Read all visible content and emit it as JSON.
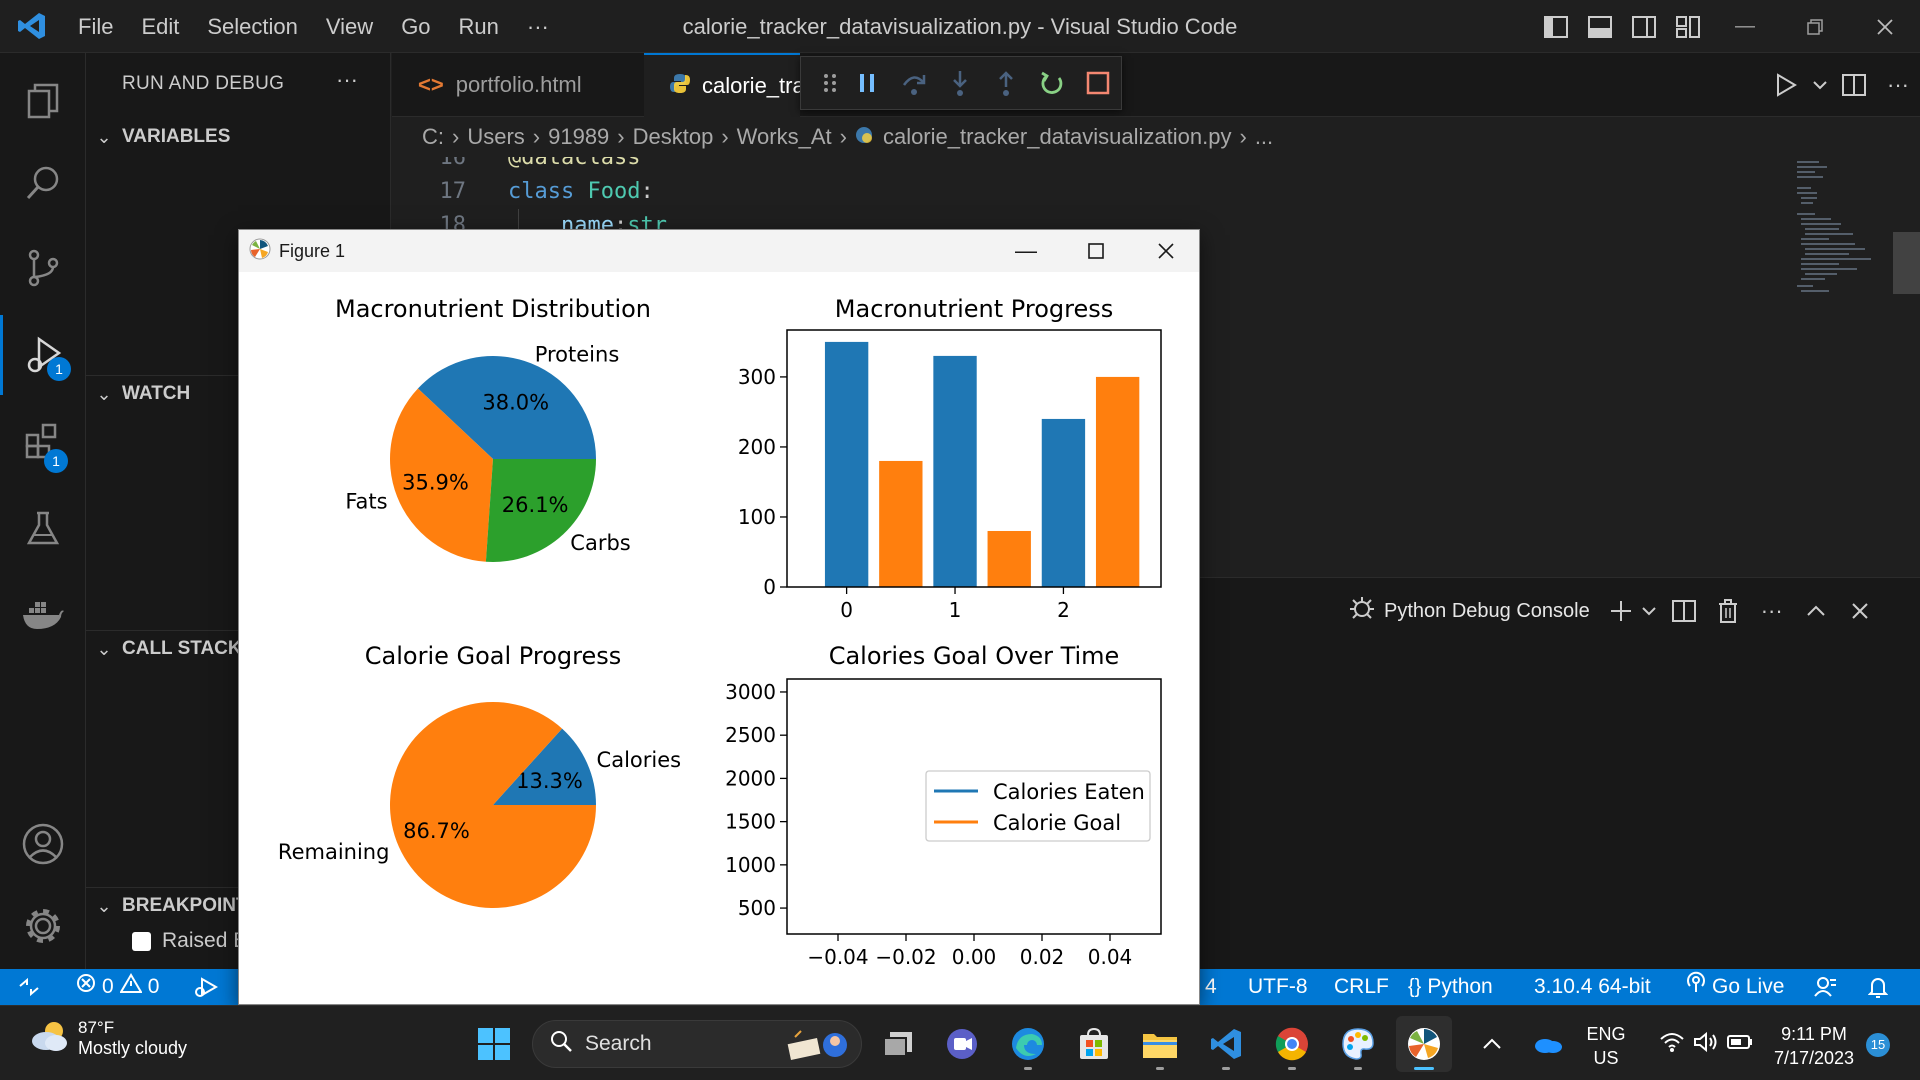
{
  "window": {
    "title": "calorie_tracker_datavisualization.py - Visual Studio Code",
    "menu": [
      "File",
      "Edit",
      "Selection",
      "View",
      "Go",
      "Run",
      "···"
    ]
  },
  "activity_bar": {
    "run_debug_badge": "1",
    "extensions_badge": "1"
  },
  "sidebar": {
    "title": "RUN AND DEBUG",
    "more": "···",
    "sections": {
      "variables": "VARIABLES",
      "watch": "WATCH",
      "call_stack": "CALL STACK",
      "breakpoints": "BREAKPOINTS"
    },
    "breakpoint_item": "Raised Exceptions"
  },
  "editor": {
    "tabs": [
      {
        "label": "portfolio.html"
      },
      {
        "label": "calorie_tracker_datavisualization.py"
      }
    ],
    "breadcrumb": [
      "C:",
      "Users",
      "91989",
      "Desktop",
      "Works_At",
      "calorie_tracker_datavisualization.py",
      "..."
    ],
    "code": [
      {
        "num": "16",
        "text": "@dataclass"
      },
      {
        "num": "17",
        "kw": "class",
        "name": "Food",
        "punct": ":"
      },
      {
        "num": "18",
        "indent": "    ",
        "var": "name",
        "sep": ":",
        "type": "str"
      }
    ]
  },
  "panel": {
    "title": "Python Debug Console"
  },
  "status_bar": {
    "errors": "0",
    "warnings": "0",
    "spaces": "4",
    "encoding": "UTF-8",
    "eol": "CRLF",
    "language": "Python",
    "interpreter": "3.10.4 64-bit",
    "go_live": "Go Live"
  },
  "figure": {
    "window_title": "Figure 1"
  },
  "chart_data": [
    {
      "type": "pie",
      "title": "Macronutrient Distribution",
      "labels": [
        "Proteins",
        "Carbs",
        "Fats"
      ],
      "values": [
        38.0,
        26.1,
        35.9
      ],
      "value_labels": [
        "38.0%",
        "26.1%",
        "35.9%"
      ],
      "colors": [
        "#1f77b4",
        "#2ca02c",
        "#ff7f0e"
      ]
    },
    {
      "type": "bar",
      "title": "Macronutrient Progress",
      "categories": [
        0,
        1,
        2
      ],
      "tick_labels": [
        "0",
        "1",
        "2"
      ],
      "series": [
        {
          "values": [
            350,
            330,
            240
          ],
          "color": "#1f77b4"
        },
        {
          "values": [
            180,
            80,
            300
          ],
          "color": "#ff7f0e"
        }
      ],
      "ylim": [
        0,
        367
      ],
      "yticks": [
        0,
        100,
        200,
        300
      ]
    },
    {
      "type": "pie",
      "title": "Calorie Goal Progress",
      "labels": [
        "Calories",
        "Remaining"
      ],
      "values": [
        13.3,
        86.7
      ],
      "value_labels": [
        "13.3%",
        "86.7%"
      ],
      "colors": [
        "#1f77b4",
        "#ff7f0e"
      ]
    },
    {
      "type": "line",
      "title": "Calories Goal Over Time",
      "series": [
        {
          "name": "Calories Eaten",
          "color": "#1f77b4",
          "x": [],
          "y": []
        },
        {
          "name": "Calorie Goal",
          "color": "#ff7f0e",
          "x": [],
          "y": []
        }
      ],
      "xlim": [
        -0.055,
        0.055
      ],
      "ylim": [
        200,
        3150
      ],
      "xticks": [
        -0.04,
        -0.02,
        0.0,
        0.02,
        0.04
      ],
      "xtick_labels": [
        "−0.04",
        "−0.02",
        "0.00",
        "0.02",
        "0.04"
      ],
      "yticks": [
        500,
        1000,
        1500,
        2000,
        2500,
        3000
      ],
      "legend": "center-right"
    }
  ],
  "taskbar": {
    "weather_temp": "87°F",
    "weather_desc": "Mostly cloudy",
    "search_placeholder": "Search",
    "lang_line1": "ENG",
    "lang_line2": "US",
    "time": "9:11 PM",
    "date": "7/17/2023",
    "notifications": "15"
  }
}
